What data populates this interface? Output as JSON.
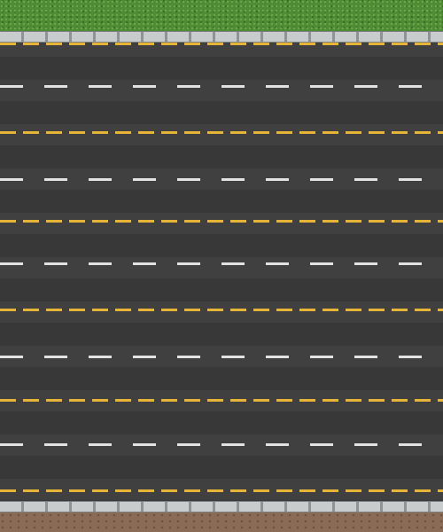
{
  "scene": {
    "type": "top-down road tile",
    "top_edge": "grass",
    "bottom_edge": "dirt",
    "lane_count": 10,
    "marking_colors": {
      "asphalt": "#3b3b3b",
      "yellow_dashes": "#e6b437",
      "white_dashes": "#e2e2e2",
      "curb": "#aeb2b4",
      "grass": "#4f8a34",
      "dirt": "#8a6b55"
    }
  }
}
